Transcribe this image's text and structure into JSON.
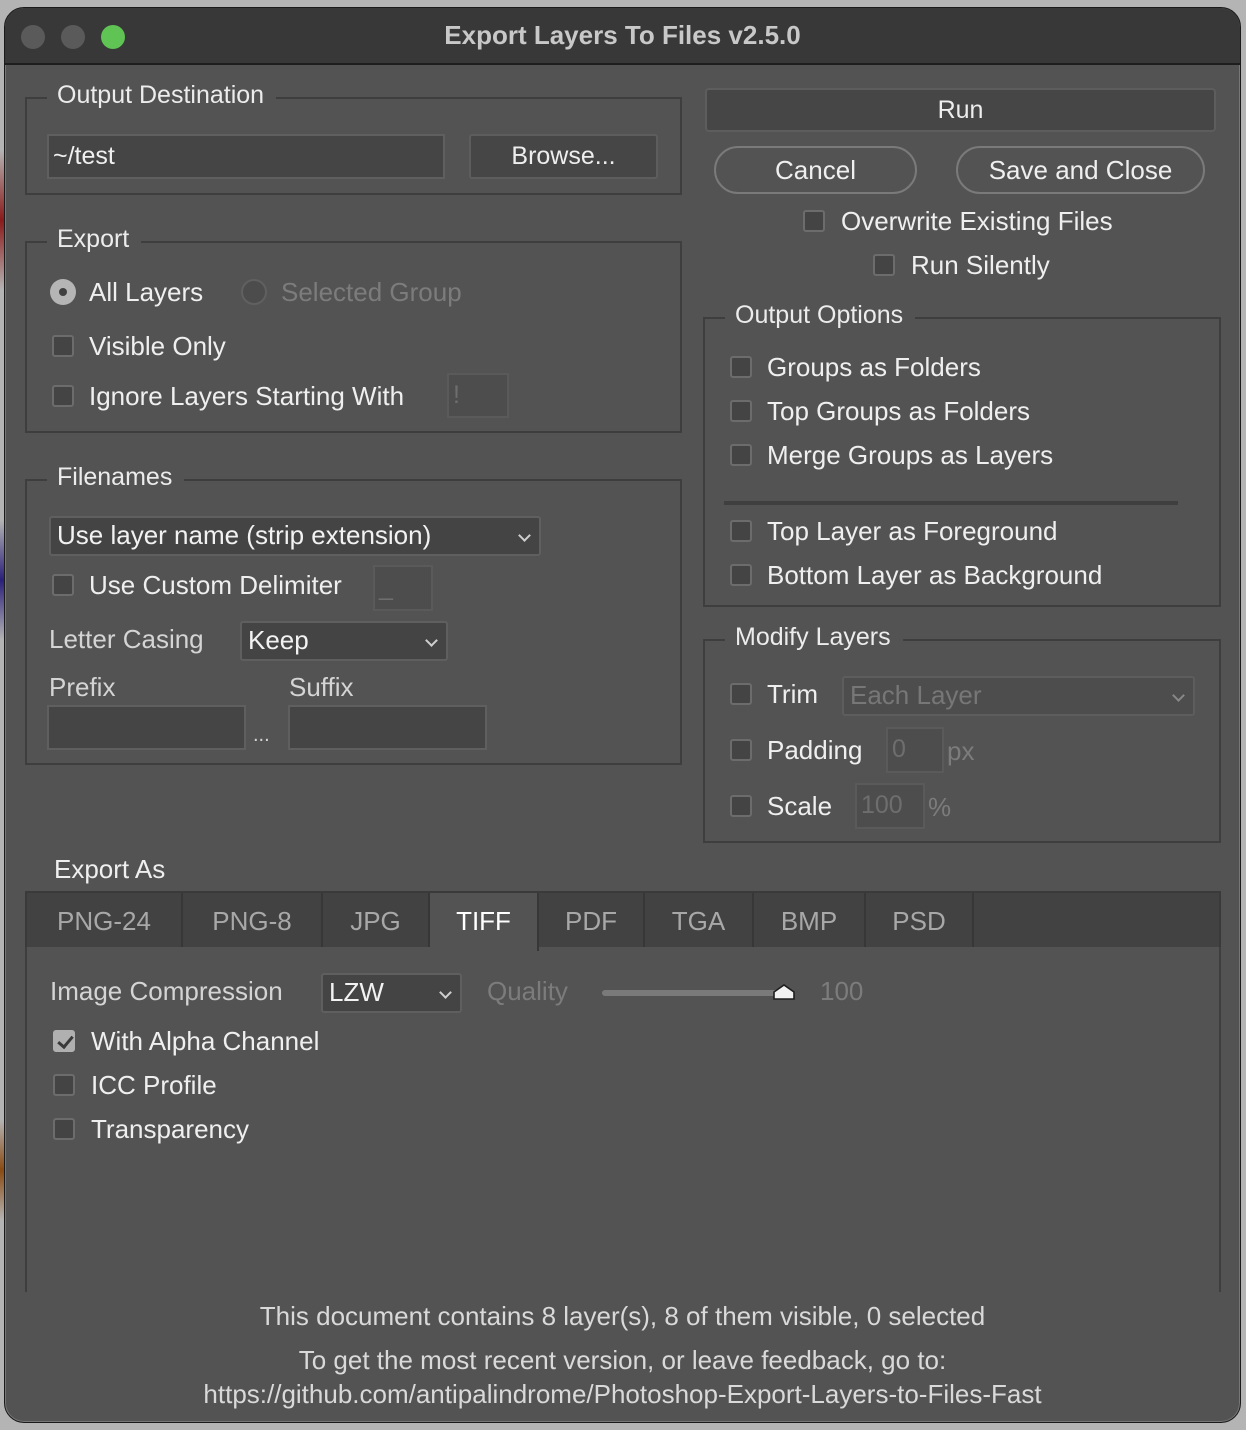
{
  "window": {
    "title": "Export Layers To Files v2.5.0",
    "traffic_lights": [
      "close",
      "minimize",
      "zoom"
    ]
  },
  "output_destination": {
    "legend": "Output Destination",
    "path_value": "~/test",
    "browse_label": "Browse..."
  },
  "actions": {
    "run_label": "Run",
    "cancel_label": "Cancel",
    "save_close_label": "Save and Close",
    "overwrite": {
      "label": "Overwrite Existing Files",
      "checked": false
    },
    "run_silently": {
      "label": "Run Silently",
      "checked": false
    }
  },
  "export": {
    "legend": "Export",
    "radio_all": {
      "label": "All Layers",
      "selected": true
    },
    "radio_group": {
      "label": "Selected Group",
      "selected": false,
      "disabled": true
    },
    "visible_only": {
      "label": "Visible Only",
      "checked": false
    },
    "ignore_layers": {
      "label": "Ignore Layers Starting With",
      "checked": false,
      "value": "!"
    }
  },
  "filenames": {
    "legend": "Filenames",
    "naming_select": "Use layer name (strip extension)",
    "custom_delimiter": {
      "label": "Use Custom Delimiter",
      "checked": false,
      "value": "_"
    },
    "letter_casing_label": "Letter Casing",
    "letter_casing_value": "Keep",
    "prefix_label": "Prefix",
    "prefix_value": "",
    "ellipsis": "...",
    "suffix_label": "Suffix",
    "suffix_value": ""
  },
  "output_options": {
    "legend": "Output Options",
    "items": [
      {
        "label": "Groups as Folders",
        "checked": false
      },
      {
        "label": "Top Groups as Folders",
        "checked": false
      },
      {
        "label": "Merge Groups as Layers",
        "checked": false
      },
      {
        "label": "Top Layer as Foreground",
        "checked": false
      },
      {
        "label": "Bottom Layer as Background",
        "checked": false
      }
    ]
  },
  "modify_layers": {
    "legend": "Modify Layers",
    "trim": {
      "label": "Trim",
      "checked": false,
      "select_value": "Each Layer"
    },
    "padding": {
      "label": "Padding",
      "checked": false,
      "value": "0",
      "unit": "px"
    },
    "scale": {
      "label": "Scale",
      "checked": false,
      "value": "100",
      "unit": "%"
    }
  },
  "export_as": {
    "label": "Export As",
    "tabs": [
      "PNG-24",
      "PNG-8",
      "JPG",
      "TIFF",
      "PDF",
      "TGA",
      "BMP",
      "PSD"
    ],
    "active_tab": "TIFF",
    "tiff": {
      "compression_label": "Image Compression",
      "compression_value": "LZW",
      "quality_label": "Quality",
      "quality_value": "100",
      "quality_fraction": 1.0,
      "with_alpha": {
        "label": "With Alpha Channel",
        "checked": true
      },
      "icc_profile": {
        "label": "ICC Profile",
        "checked": false
      },
      "transparency": {
        "label": "Transparency",
        "checked": false
      }
    }
  },
  "footer": {
    "status": "This document contains 8 layer(s), 8 of them visible, 0 selected",
    "feedback": "To get the most recent version, or leave feedback, go to:",
    "url": "https://github.com/antipalindrome/Photoshop-Export-Layers-to-Files-Fast"
  },
  "colors": {
    "window_bg": "#535353",
    "titlebar_bg": "#383838",
    "zoom_button": "#5fc454"
  }
}
